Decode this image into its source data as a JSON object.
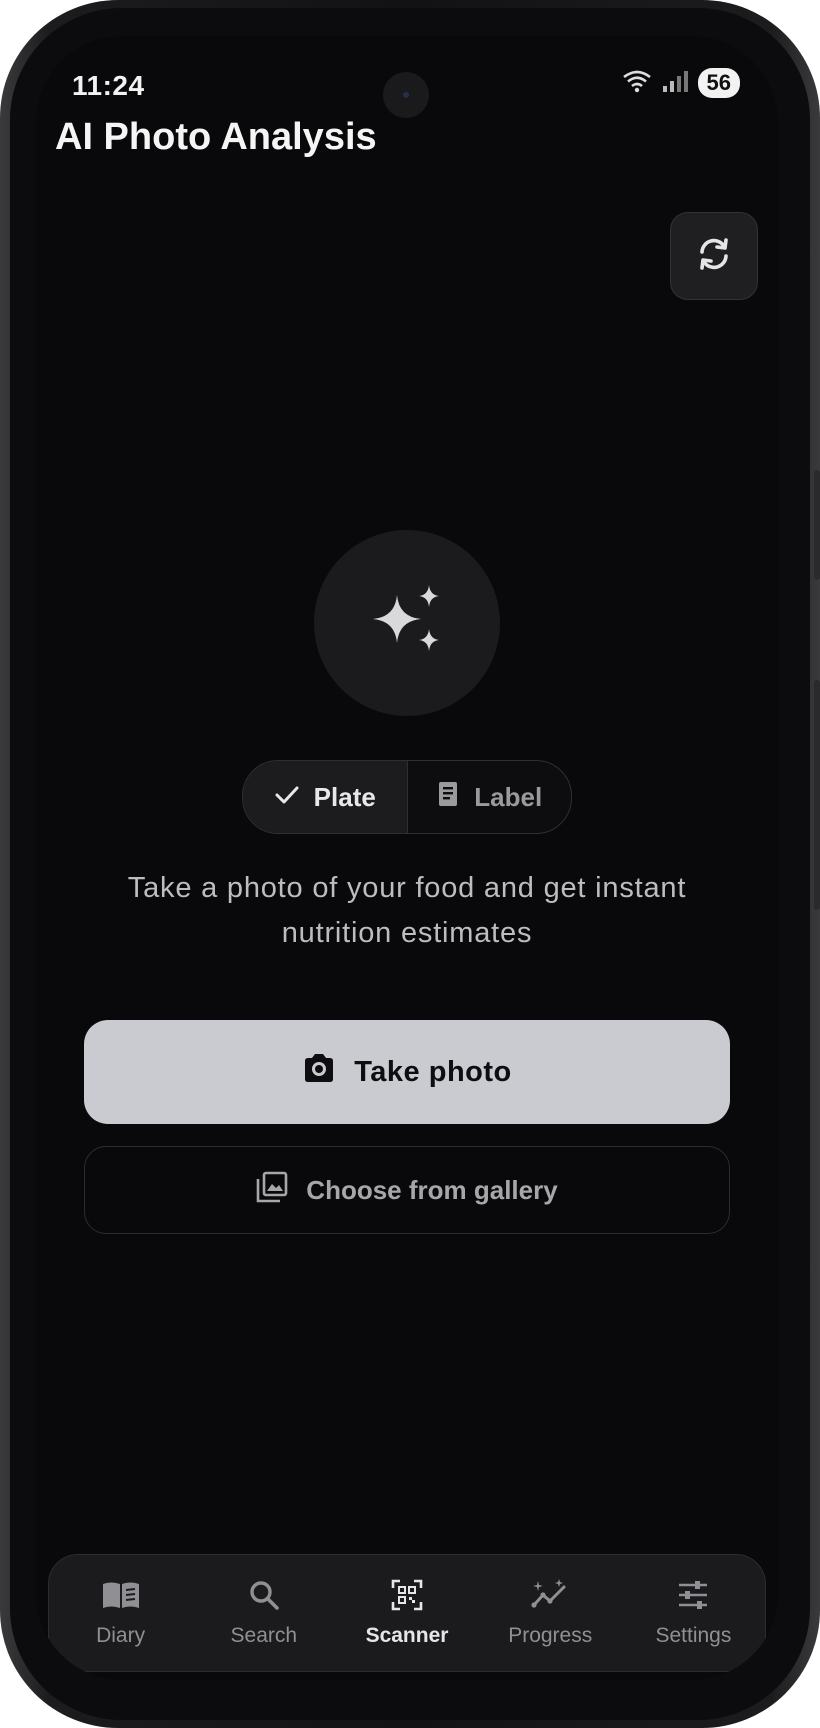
{
  "status_bar": {
    "time": "11:24",
    "battery": "56"
  },
  "header": {
    "title": "AI Photo Analysis"
  },
  "mode_toggle": {
    "options": [
      {
        "label": "Plate",
        "selected": true
      },
      {
        "label": "Label",
        "selected": false
      }
    ]
  },
  "subtitle": "Take a photo of your food and get instant nutrition estimates",
  "actions": {
    "take_photo": "Take photo",
    "gallery": "Choose from gallery"
  },
  "bottom_nav": {
    "items": [
      {
        "label": "Diary",
        "icon": "book-icon"
      },
      {
        "label": "Search",
        "icon": "search-icon"
      },
      {
        "label": "Scanner",
        "icon": "qr-scan-icon",
        "active": true
      },
      {
        "label": "Progress",
        "icon": "trend-icon"
      },
      {
        "label": "Settings",
        "icon": "sliders-icon"
      }
    ]
  },
  "colors": {
    "background": "#09090b",
    "primary_button": "#c9cbd0",
    "surface": "#1b1b1e",
    "muted_text": "#8f8f94"
  }
}
